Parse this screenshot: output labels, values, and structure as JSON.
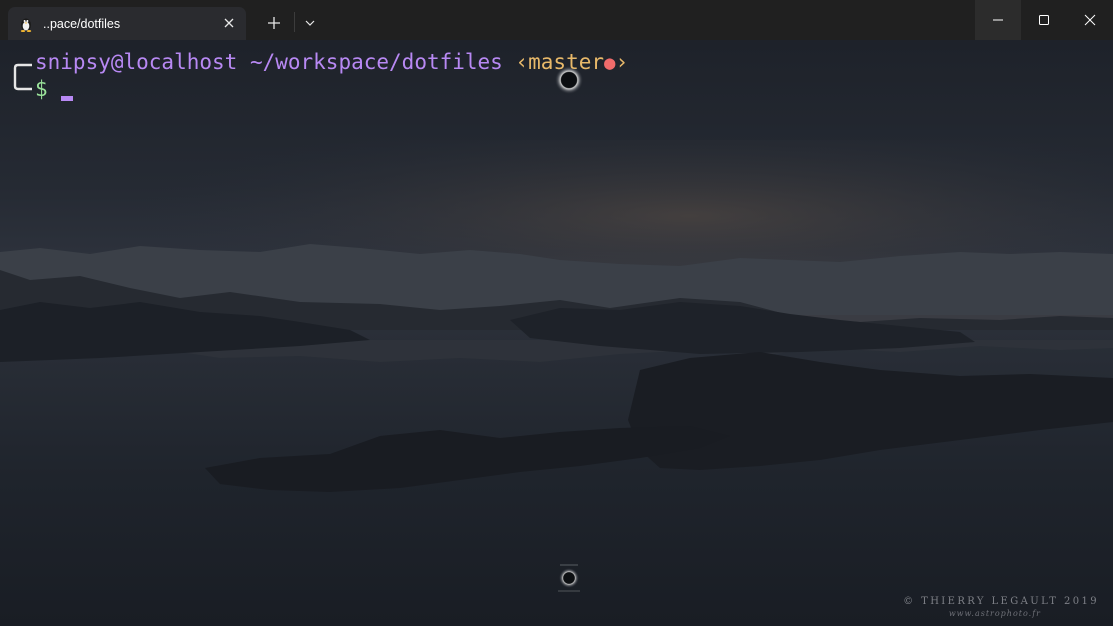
{
  "tab": {
    "title": "..pace/dotfiles",
    "icon": "linux-penguin-icon"
  },
  "titlebar": {
    "new_tab_icon": "plus-icon",
    "dropdown_icon": "chevron-down-icon",
    "minimize_icon": "minimize-icon",
    "maximize_icon": "maximize-icon",
    "close_icon": "close-icon"
  },
  "prompt": {
    "user_host": "snipsy@localhost",
    "path": "~/workspace/dotfiles",
    "git_open": "‹",
    "git_branch": "master",
    "git_dirty": "●",
    "git_close": "›",
    "symbol": "$"
  },
  "background": {
    "credit": "© THIERRY LEGAULT 2019",
    "credit_url": "www.astrophoto.fr"
  },
  "colors": {
    "accent_purple": "#b889f4",
    "git_yellow": "#e8b96a",
    "dirty_red": "#f06b6b",
    "dollar_green": "#9be39b"
  }
}
